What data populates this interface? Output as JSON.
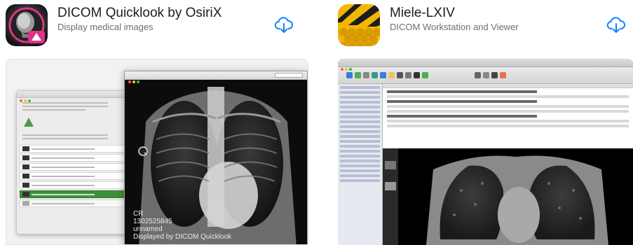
{
  "apps": [
    {
      "title": "DICOM Quicklook by OsiriX",
      "subtitle": "Display medical images",
      "download_icon": "cloud-download-icon",
      "screenshot": {
        "overlay_lines": [
          "CR",
          "1302525845",
          "unnamed",
          "Displayed by DICOM Quicklook"
        ]
      }
    },
    {
      "title": "Miele-LXIV",
      "subtitle": "DICOM Workstation and Viewer",
      "download_icon": "cloud-download-icon"
    }
  ],
  "colors": {
    "accent_blue": "#0a84ff",
    "title_text": "#1d1d1f",
    "subtitle_text": "#6e6e73",
    "osirix_pink": "#e0328a",
    "miele_yellow": "#f2b705"
  }
}
